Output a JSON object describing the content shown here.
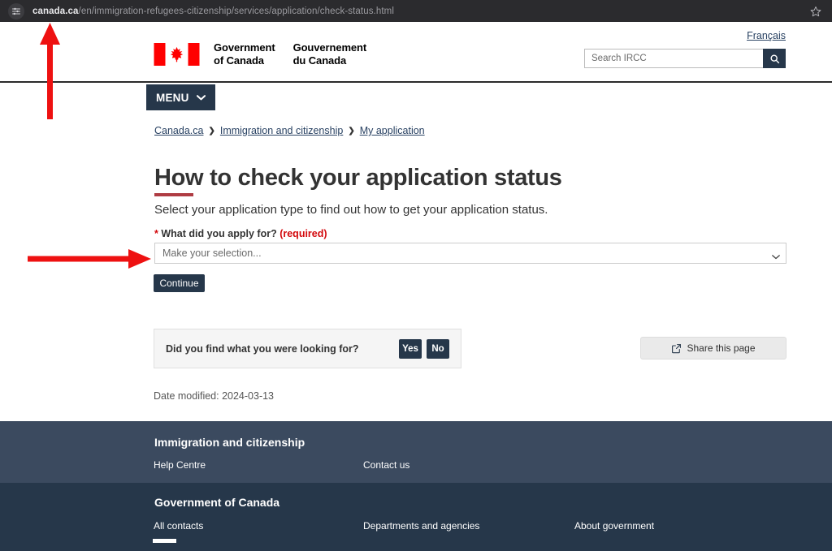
{
  "browser": {
    "site_icon": "tune-icon",
    "url_domain": "canada.ca",
    "url_path": "/en/immigration-refugees-citizenship/services/application/check-status.html",
    "bookmark_icon": "star-icon"
  },
  "header": {
    "lang_link": "Français",
    "brand_en_line1": "Government",
    "brand_en_line2": "of Canada",
    "brand_fr_line1": "Gouvernement",
    "brand_fr_line2": "du Canada",
    "search_placeholder": "Search IRCC",
    "search_value": "",
    "search_icon": "search-icon",
    "menu_label": "MENU",
    "menu_icon": "chevron-down-icon"
  },
  "breadcrumb": {
    "items": [
      {
        "label": "Canada.ca"
      },
      {
        "label": "Immigration and citizenship"
      },
      {
        "label": "My application"
      }
    ],
    "separator": "❯"
  },
  "main": {
    "title": "How to check your application status",
    "lede": "Select your application type to find out how to get your application status.",
    "field_star": "*",
    "field_label": "What did you apply for?",
    "field_required": "(required)",
    "select_value": "Make your selection...",
    "select_options": [
      "Make your selection..."
    ],
    "select_icon": "chevron-down-icon",
    "continue_label": "Continue",
    "date_modified": "Date modified: 2024-03-13"
  },
  "feedback": {
    "question": "Did you find what you were looking for?",
    "yes_label": "Yes",
    "no_label": "No"
  },
  "share": {
    "label": "Share this page",
    "icon": "share-icon"
  },
  "footer": {
    "section1_heading": "Immigration and citizenship",
    "section1_links": [
      "Help Centre",
      "Contact us"
    ],
    "section2_heading": "Government of Canada",
    "section2_links": [
      "All contacts",
      "Departments and agencies",
      "About government"
    ]
  },
  "annotations": {
    "arrow_up_target": "url-bar",
    "arrow_right_target": "application-type-select",
    "color": "#ee1111"
  },
  "colors": {
    "brand_navy": "#26374a",
    "footer_mid": "#3b4a5f",
    "accent_red": "#af3c43",
    "required_red": "#d3080c",
    "flag_red": "#ff0000",
    "annotation_red": "#ee1111"
  }
}
